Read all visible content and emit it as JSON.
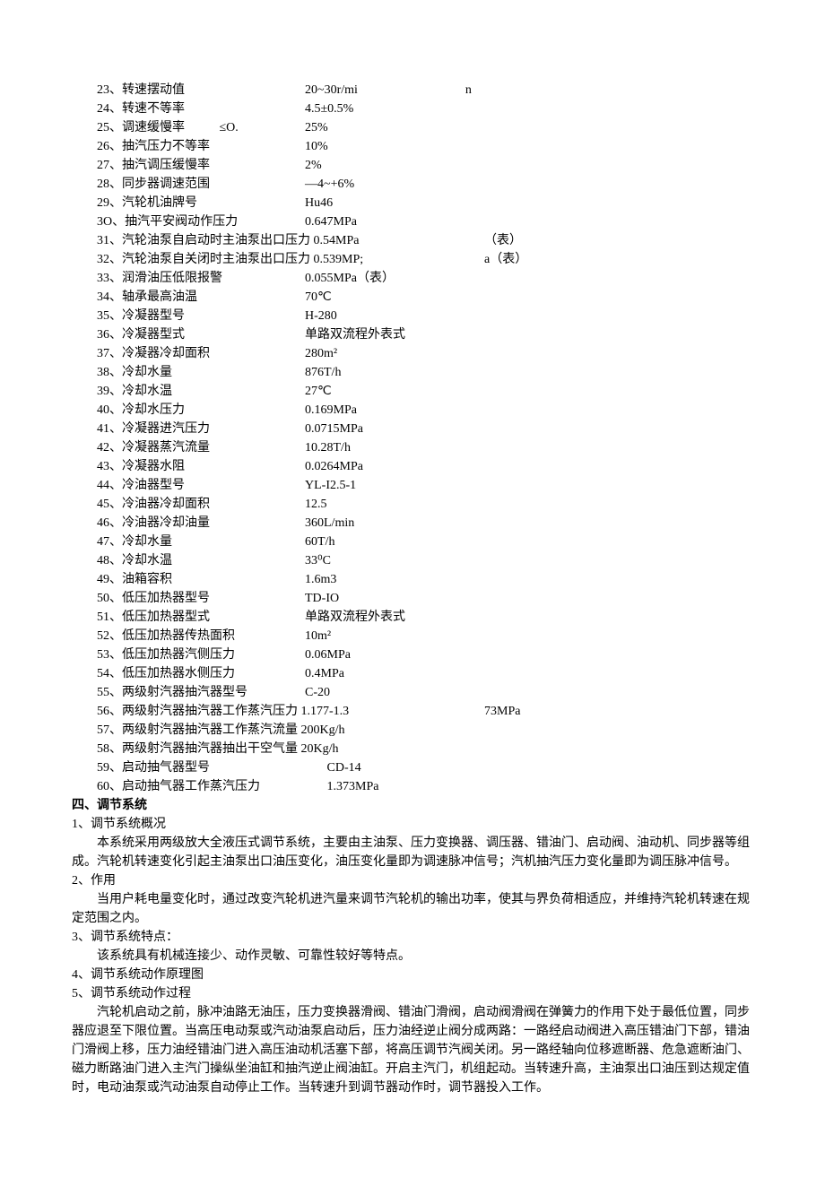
{
  "specs": [
    {
      "num": "23",
      "label": "转速摆动值",
      "value": "20~30r/mi",
      "extra": "n",
      "wide": false,
      "extraClass": "spec-extra"
    },
    {
      "num": "24",
      "label": "转速不等率",
      "value": "4.5±0.5%",
      "extra": "",
      "wide": false
    },
    {
      "num": "25",
      "label": "调速缓慢率           ≤O.",
      "value": "25%",
      "extra": "",
      "wide": false
    },
    {
      "num": "26",
      "label": "抽汽压力不等率",
      "value": "10%",
      "extra": "",
      "wide": false
    },
    {
      "num": "27",
      "label": "抽汽调压缓慢率",
      "value": "2%",
      "extra": "",
      "wide": false
    },
    {
      "num": "28",
      "label": "同步器调速范围",
      "value": "—4~+6%",
      "extra": "",
      "wide": false
    },
    {
      "num": "29",
      "label": "汽轮机油牌号",
      "value": "Hu46",
      "extra": "",
      "wide": false
    },
    {
      "num": "3O",
      "label": "抽汽平安阀动作压力",
      "value": "0.647MPa",
      "extra": "",
      "wide": false
    },
    {
      "num": "31",
      "label": "汽轮油泵自启动时主油泵出口压力 0.54MPa",
      "value": "",
      "extra": "（表）",
      "wide": true
    },
    {
      "num": "32",
      "label": "汽轮油泵自关闭时主油泵出口压力 0.539MP;",
      "value": "",
      "extra": "a（表）",
      "wide": true
    },
    {
      "num": "33",
      "label": "润滑油压低限报警",
      "value": "0.055MPa（表）",
      "extra": "",
      "wide": false
    },
    {
      "num": "34",
      "label": "轴承最高油温",
      "value": "70℃",
      "extra": "",
      "wide": false
    },
    {
      "num": "35",
      "label": "冷凝器型号",
      "value": "H-280",
      "extra": "",
      "wide": false
    },
    {
      "num": "36",
      "label": "冷凝器型式",
      "value": "单路双流程外表式",
      "extra": "",
      "wide": false
    },
    {
      "num": "37",
      "label": "冷凝器冷却面积",
      "value": "280m²",
      "extra": "",
      "wide": false
    },
    {
      "num": "38",
      "label": "冷却水量",
      "value": "876T/h",
      "extra": "",
      "wide": false
    },
    {
      "num": "39",
      "label": "冷却水温",
      "value": "27℃",
      "extra": "",
      "wide": false
    },
    {
      "num": "40",
      "label": "冷却水压力",
      "value": "0.169MPa",
      "extra": "",
      "wide": false
    },
    {
      "num": "41",
      "label": "冷凝器进汽压力",
      "value": "0.0715MPa",
      "extra": "",
      "wide": false
    },
    {
      "num": "42",
      "label": "冷凝器蒸汽流量",
      "value": "10.28T/h",
      "extra": "",
      "wide": false
    },
    {
      "num": "43",
      "label": "冷凝器水阻",
      "value": "0.0264MPa",
      "extra": "",
      "wide": false
    },
    {
      "num": "44",
      "label": "冷油器型号",
      "value": "YL-I2.5-1",
      "extra": "",
      "wide": false
    },
    {
      "num": "45",
      "label": "冷油器冷却面积",
      "value": "12.5",
      "extra": "",
      "wide": false
    },
    {
      "num": "46",
      "label": "冷油器冷却油量",
      "value": "360L/min",
      "extra": "",
      "wide": false
    },
    {
      "num": "47",
      "label": "冷却水量",
      "value": "60T/h",
      "extra": "",
      "wide": false
    },
    {
      "num": "48",
      "label": "冷却水温",
      "value": "33⁰C",
      "extra": "",
      "wide": false
    },
    {
      "num": "49",
      "label": "油箱容积",
      "value": "1.6m3",
      "extra": "",
      "wide": false
    },
    {
      "num": "50",
      "label": "低压加热器型号",
      "value": "TD-IO",
      "extra": "",
      "wide": false
    },
    {
      "num": "51",
      "label": "低压加热器型式",
      "value": "单路双流程外表式",
      "extra": "",
      "wide": false
    },
    {
      "num": "52",
      "label": "低压加热器传热面积",
      "value": "10m²",
      "extra": "",
      "wide": false
    },
    {
      "num": "53",
      "label": "低压加热器汽侧压力",
      "value": "0.06MPa",
      "extra": "",
      "wide": false
    },
    {
      "num": "54",
      "label": "低压加热器水侧压力",
      "value": "0.4MPa",
      "extra": "",
      "wide": false
    },
    {
      "num": "55",
      "label": "两级射汽器抽汽器型号",
      "value": "C-20",
      "extra": "",
      "wide": false
    },
    {
      "num": "56",
      "label": "两级射汽器抽汽器工作蒸汽压力 1.177-1.3",
      "value": "",
      "extra": "73MPa",
      "wide": true
    },
    {
      "num": "57",
      "label": "两级射汽器抽汽器工作蒸汽流量 200Kg/h",
      "value": "",
      "extra": "",
      "wide": true
    },
    {
      "num": "58",
      "label": "两级射汽器抽汽器抽出干空气量 20Kg/h",
      "value": "",
      "extra": "",
      "wide": true
    },
    {
      "num": "59",
      "label": "启动抽气器型号",
      "value": "       CD-14",
      "extra": "",
      "wide": false
    },
    {
      "num": "60",
      "label": "启动抽气器工作蒸汽压力",
      "value": "       1.373MPa",
      "extra": "",
      "wide": false
    }
  ],
  "section4": {
    "title": "四、调节系统",
    "item1_title": "1、调节系统概况",
    "item1_body": "本系统采用两级放大全液压式调节系统，主要由主油泵、压力变换器、调压器、错油门、启动阀、油动机、同步器等组成。汽轮机转速变化引起主油泵出口油压变化，油压变化量即为调速脉冲信号；汽机抽汽压力变化量即为调压脉冲信号。",
    "item2_title": "2、作用",
    "item2_body": "当用户耗电量变化时，通过改变汽轮机进汽量来调节汽轮机的输出功率，使其与界负荷相适应，并维持汽轮机转速在规定范围之内。",
    "item3_title": "3、调节系统特点：",
    "item3_body": "该系统具有机械连接少、动作灵敏、可靠性较好等特点。",
    "item4_title": "4、调节系统动作原理图",
    "item5_title": "5、调节系统动作过程",
    "item5_body": "汽轮机启动之前，脉冲油路无油压，压力变换器滑阀、错油门滑阀，启动阀滑阀在弹簧力的作用下处于最低位置，同步器应退至下限位置。当高压电动泵或汽动油泵启动后，压力油经逆止阀分成两路：一路经启动阀进入高压错油门下部，错油门滑阀上移，压力油经错油门进入高压油动机活塞下部，将高压调节汽阀关闭。另一路经轴向位移遮断器、危急遮断油门、磁力断路油门进入主汽门操纵坐油缸和抽汽逆止阀油缸。开启主汽门，机组起动。当转速升高，主油泵出口油压到达规定值时，电动油泵或汽动油泵自动停止工作。当转速升到调节器动作时，调节器投入工作。"
  }
}
